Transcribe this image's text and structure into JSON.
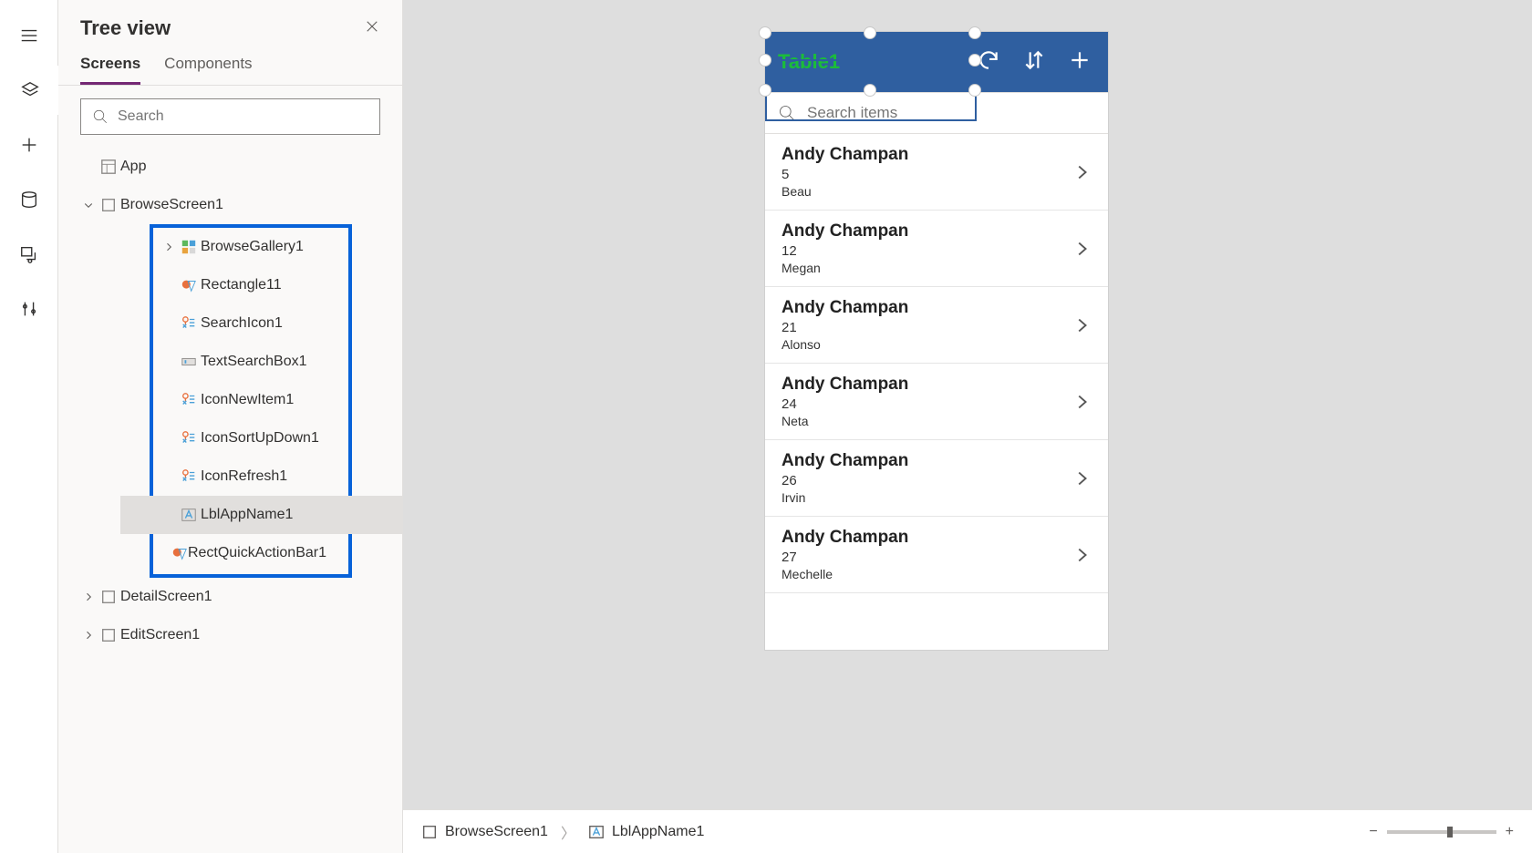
{
  "treeview": {
    "title": "Tree view",
    "tabs": {
      "screens": "Screens",
      "components": "Components"
    },
    "search_placeholder": "Search",
    "app_label": "App",
    "screens": {
      "browse": "BrowseScreen1",
      "detail": "DetailScreen1",
      "edit": "EditScreen1"
    },
    "browse_children": {
      "gallery": "BrowseGallery1",
      "rect": "Rectangle11",
      "searchicon": "SearchIcon1",
      "textbox": "TextSearchBox1",
      "iconnew": "IconNewItem1",
      "iconsort": "IconSortUpDown1",
      "iconrefresh": "IconRefresh1",
      "lblapp": "LblAppName1",
      "rectquick": "RectQuickActionBar1"
    }
  },
  "preview": {
    "appbar_title": "Table1",
    "search_placeholder": "Search items",
    "items": [
      {
        "title": "Andy Champan",
        "n": "5",
        "sub": "Beau"
      },
      {
        "title": "Andy Champan",
        "n": "12",
        "sub": "Megan"
      },
      {
        "title": "Andy Champan",
        "n": "21",
        "sub": "Alonso"
      },
      {
        "title": "Andy Champan",
        "n": "24",
        "sub": "Neta"
      },
      {
        "title": "Andy Champan",
        "n": "26",
        "sub": "Irvin"
      },
      {
        "title": "Andy Champan",
        "n": "27",
        "sub": "Mechelle"
      }
    ]
  },
  "breadcrumb": {
    "a": "BrowseScreen1",
    "b": "LblAppName1"
  }
}
